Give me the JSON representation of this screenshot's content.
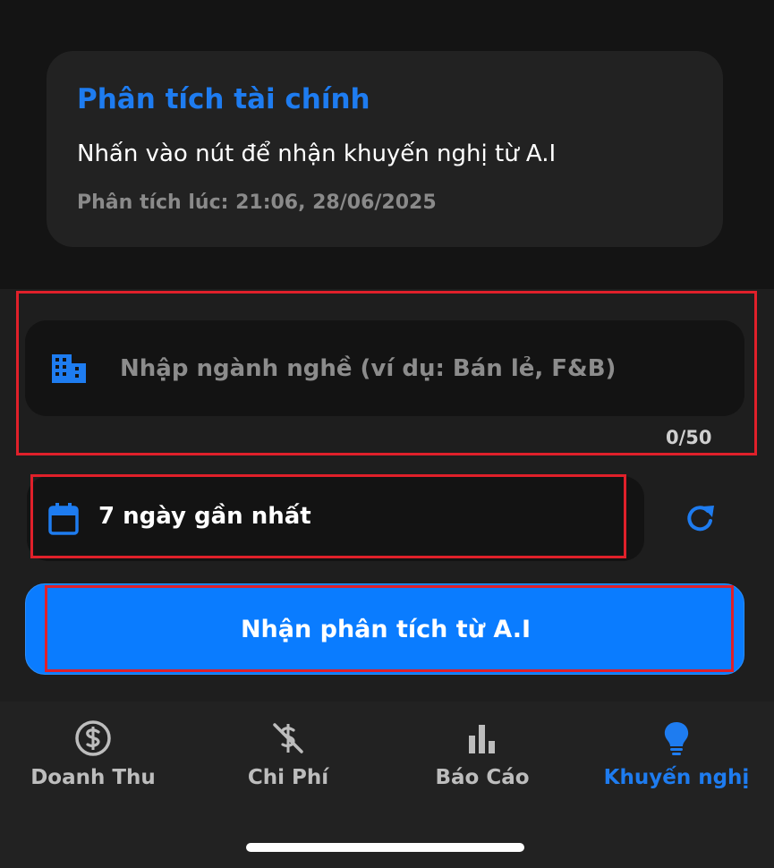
{
  "card": {
    "title": "Phân tích tài chính",
    "description": "Nhấn vào nút để nhận khuyến nghị từ A.I",
    "timestamp": "Phân tích lúc: 21:06, 28/06/2025"
  },
  "industry": {
    "placeholder": "Nhập ngành nghề (ví dụ: Bán lẻ, F&B)",
    "value": "",
    "char_count": "0/50",
    "icon": "building-icon"
  },
  "date_range": {
    "label": "7 ngày gần nhất",
    "icon": "calendar-icon"
  },
  "refresh": {
    "icon": "refresh-icon"
  },
  "analyze_button": {
    "label": "Nhận phân tích từ A.I"
  },
  "nav": {
    "items": [
      {
        "label": "Doanh Thu",
        "icon": "dollar-circle-icon",
        "active": false
      },
      {
        "label": "Chi Phí",
        "icon": "dollar-off-icon",
        "active": false
      },
      {
        "label": "Báo Cáo",
        "icon": "bar-chart-icon",
        "active": false
      },
      {
        "label": "Khuyến nghị",
        "icon": "lightbulb-icon",
        "active": true
      }
    ]
  },
  "colors": {
    "accent": "#1e7cf0",
    "button": "#0a7cff",
    "highlight": "#e0202a",
    "background": "#1e1e1e"
  }
}
